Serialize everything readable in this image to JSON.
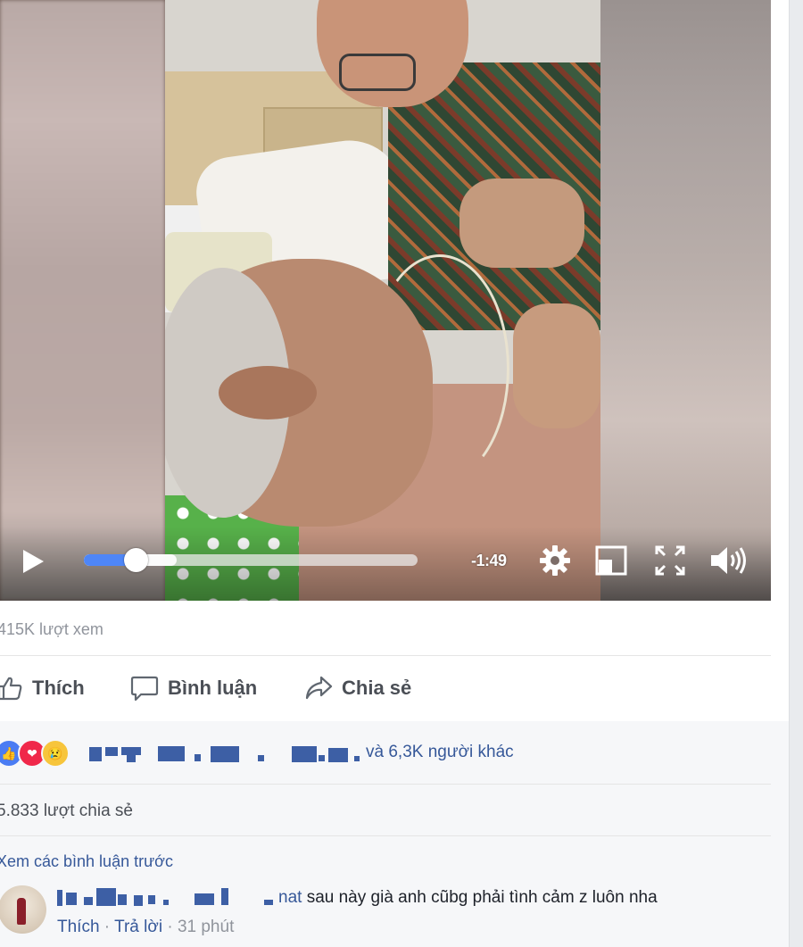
{
  "video": {
    "time_remaining": "-1:49",
    "progress": 0.156,
    "buffered": 0.278
  },
  "post": {
    "views": "415K lượt xem",
    "actions": {
      "like": "Thích",
      "comment": "Bình luận",
      "share": "Chia sẻ"
    },
    "reactions": {
      "icons": [
        "like-reaction",
        "love-reaction",
        "sad-reaction"
      ],
      "others_text": "và 6,3K người khác"
    },
    "shares": "5.833 lượt chia sẻ",
    "view_previous_comments": "Xem các bình luận trước"
  },
  "comment": {
    "name_tail": "nat",
    "text": "sau này già anh cũbg phải tình cảm z luôn nha",
    "like": "Thích",
    "separator1": " · ",
    "reply": "Trả lời",
    "separator2": " · ",
    "time": "31 phút"
  },
  "colors": {
    "link": "#365899",
    "progress": "#4e86f7",
    "muted": "#90949c",
    "action_text": "#4b4f56",
    "redaction": "#3d5fa5"
  }
}
